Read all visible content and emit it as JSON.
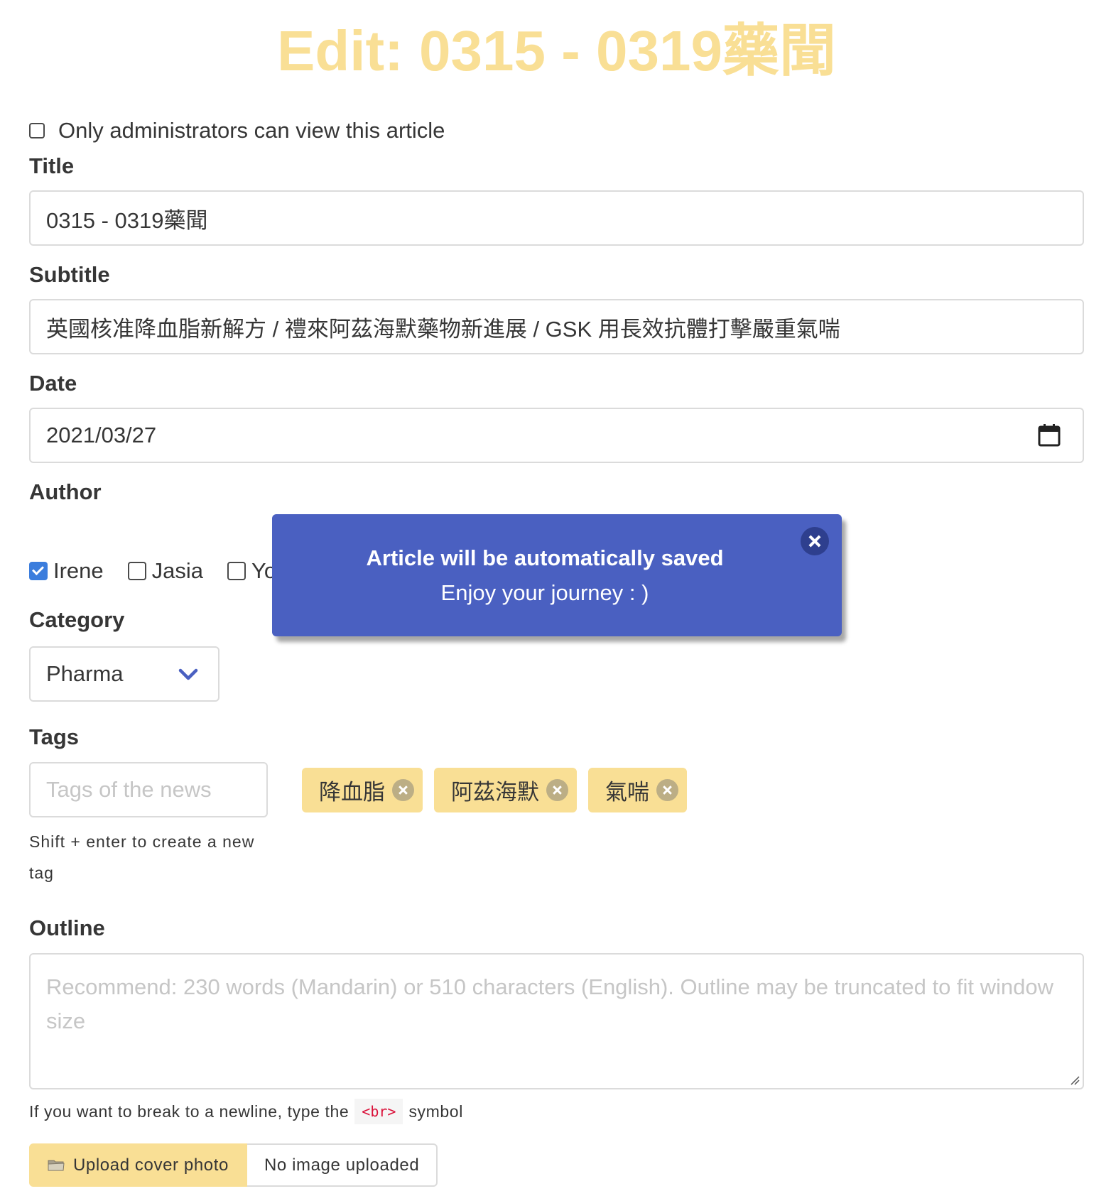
{
  "page": {
    "title": "Edit: 0315 - 0319藥聞"
  },
  "admin_only": {
    "label": "Only administrators can view this article",
    "checked": false
  },
  "title_field": {
    "label": "Title",
    "value": "0315 - 0319藥聞"
  },
  "subtitle_field": {
    "label": "Subtitle",
    "value": "英國核准降血脂新解方 / 禮來阿茲海默藥物新進展 / GSK 用長效抗體打擊嚴重氣喘"
  },
  "date_field": {
    "label": "Date",
    "value": "2021/03/27",
    "icon": "calendar-icon"
  },
  "author_field": {
    "label": "Author",
    "options": [
      {
        "label": "Irene",
        "checked": true
      },
      {
        "label": "Jasia",
        "checked": false
      },
      {
        "label": "Yo",
        "checked": false
      }
    ]
  },
  "category_field": {
    "label": "Category",
    "selected": "Pharma",
    "icon": "chevron-down-icon"
  },
  "tags_field": {
    "label": "Tags",
    "placeholder": "Tags of the news",
    "help": "Shift + enter to create a new tag",
    "tags": [
      "降血脂",
      "阿茲海默",
      "氣喘"
    ]
  },
  "outline_field": {
    "label": "Outline",
    "placeholder": "Recommend: 230 words (Mandarin) or 510 characters (English). Outline may be truncated to fit window size",
    "help_prefix": "If you want to break to a newline, type the",
    "help_code": "<br>",
    "help_suffix": "symbol"
  },
  "upload": {
    "button_label": "Upload cover photo",
    "filename": "No image uploaded",
    "icon": "folder-icon"
  },
  "toast": {
    "title": "Article will be automatically saved",
    "message": "Enjoy your journey : )",
    "close_icon": "close-icon"
  },
  "colors": {
    "accent_yellow": "#f9df95",
    "toast_blue": "#4a60c1",
    "checkbox_blue": "#3b7ddd",
    "code_red": "#da1039"
  }
}
